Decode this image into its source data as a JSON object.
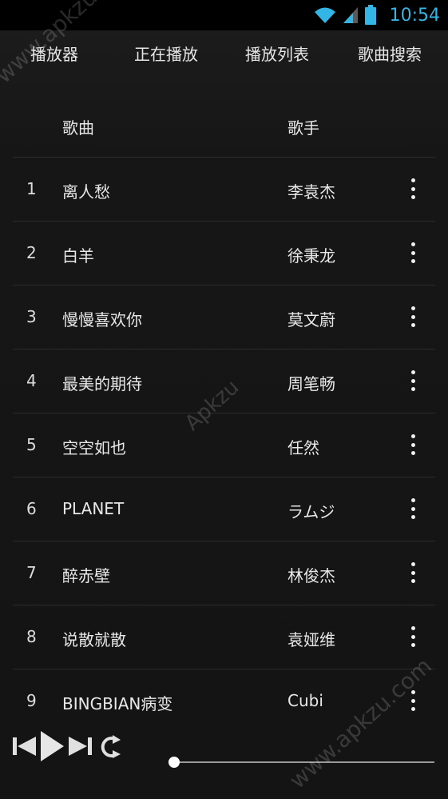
{
  "status_bar": {
    "time": "10:54",
    "icons": [
      "wifi-icon",
      "signal-icon",
      "battery-icon"
    ]
  },
  "tabs": [
    {
      "label": "播放器"
    },
    {
      "label": "正在播放"
    },
    {
      "label": "播放列表"
    },
    {
      "label": "歌曲搜索"
    }
  ],
  "list_header": {
    "song": "歌曲",
    "artist": "歌手"
  },
  "songs": [
    {
      "num": "1",
      "title": "离人愁",
      "artist": "李袁杰"
    },
    {
      "num": "2",
      "title": "白羊",
      "artist": "徐秉龙"
    },
    {
      "num": "3",
      "title": "慢慢喜欢你",
      "artist": "莫文蔚"
    },
    {
      "num": "4",
      "title": "最美的期待",
      "artist": "周笔畅"
    },
    {
      "num": "5",
      "title": "空空如也",
      "artist": "任然"
    },
    {
      "num": "6",
      "title": "PLANET",
      "artist": "ラムジ"
    },
    {
      "num": "7",
      "title": "醉赤壁",
      "artist": "林俊杰"
    },
    {
      "num": "8",
      "title": "说散就散",
      "artist": "袁娅维"
    },
    {
      "num": "9",
      "title": "BINGBIAN病变",
      "artist": "Cubi"
    }
  ],
  "player": {
    "controls": [
      "previous-icon",
      "play-icon",
      "next-icon",
      "repeat-icon"
    ],
    "progress": 0
  },
  "watermarks": [
    "www.apkzu.com",
    "Apkzu",
    "www.apkzu.com"
  ],
  "colors": {
    "status_time": "#33b5e5",
    "background": "#151515",
    "text": "#e8e8e8"
  }
}
